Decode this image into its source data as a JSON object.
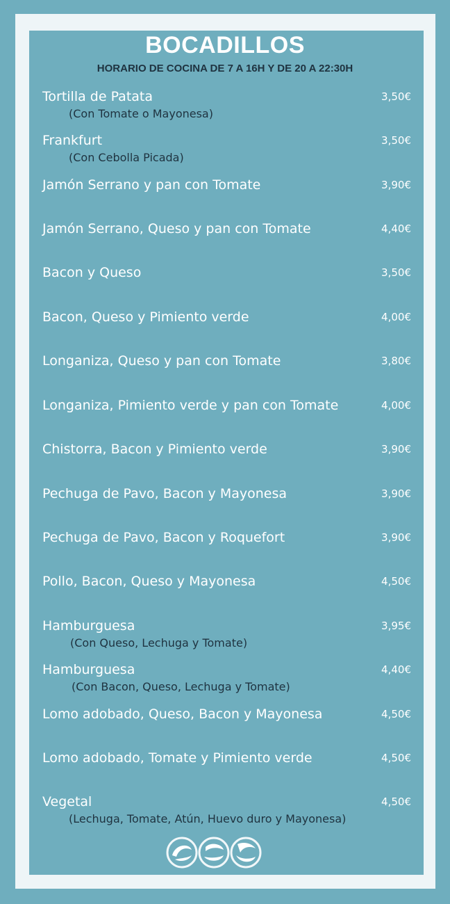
{
  "menu": {
    "title": "BOCADILLOS",
    "subtitle": "HORARIO DE COCINA DE 7 A 16H Y DE 20 A 22:30H",
    "items": [
      {
        "name": "Tortilla de Patata",
        "note": "(Con Tomate o Mayonesa)",
        "price": "3,50€"
      },
      {
        "name": "Frankfurt",
        "note": "(Con Cebolla Picada)",
        "price": "3,50€"
      },
      {
        "name": "Jamón Serrano y pan con Tomate",
        "note": "",
        "price": "3,90€"
      },
      {
        "name": "Jamón Serrano, Queso y pan con Tomate",
        "note": "",
        "price": "4,40€"
      },
      {
        "name": "Bacon y Queso",
        "note": "",
        "price": "3,50€"
      },
      {
        "name": "Bacon, Queso y Pimiento verde",
        "note": "",
        "price": "4,00€"
      },
      {
        "name": "Longaniza, Queso y pan con Tomate",
        "note": "",
        "price": "3,80€"
      },
      {
        "name": "Longaniza,  Pimiento verde y pan con Tomate",
        "note": "",
        "price": "4,00€"
      },
      {
        "name": "Chistorra, Bacon y Pimiento verde",
        "note": "",
        "price": "3,90€"
      },
      {
        "name": "Pechuga de Pavo, Bacon y Mayonesa",
        "note": "",
        "price": "3,90€"
      },
      {
        "name": "Pechuga de Pavo, Bacon y Roquefort",
        "note": "",
        "price": "3,90€"
      },
      {
        "name": "Pollo, Bacon, Queso y Mayonesa",
        "note": "",
        "price": "4,50€"
      },
      {
        "name": "Hamburguesa",
        "note": "(Con Queso, Lechuga y Tomate)",
        "price": "3,95€"
      },
      {
        "name": "Hamburguesa",
        "note": "(Con  Bacon, Queso, Lechuga y Tomate)",
        "price": "4,40€"
      },
      {
        "name": "Lomo adobado, Queso, Bacon y Mayonesa",
        "note": "",
        "price": "4,50€"
      },
      {
        "name": "Lomo adobado, Tomate y Pimiento verde",
        "note": "",
        "price": "4,50€"
      },
      {
        "name": "Vegetal",
        "note": "(Lechuga, Tomate, Atún, Huevo duro y Mayonesa)",
        "price": "4,50€"
      }
    ]
  },
  "colors": {
    "background": "#6faebe",
    "frame": "#eef5f7",
    "text_light": "#ffffff",
    "text_dark": "#1f3340"
  },
  "logo": {
    "icon": "circular-swirl-logo-icon"
  }
}
